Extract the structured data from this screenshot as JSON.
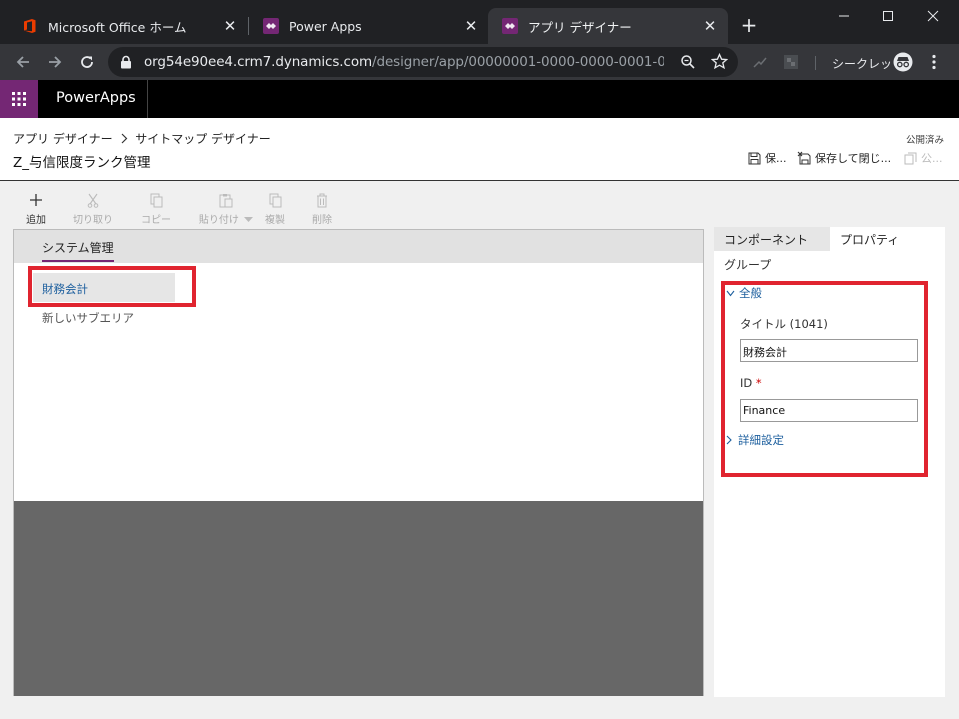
{
  "browser": {
    "tabs": [
      {
        "label": "Microsoft Office ホーム",
        "active": false
      },
      {
        "label": "Power Apps",
        "active": false
      },
      {
        "label": "アプリ デザイナー",
        "active": true
      }
    ],
    "url_host": "org54e90ee4.crm7.dynamics.com",
    "url_path": "/designer/app/00000001-0000-0000-0001-00000...",
    "incognito_label": "シークレット"
  },
  "header": {
    "product": "PowerApps"
  },
  "designer": {
    "breadcrumb_app": "アプリ デザイナー",
    "breadcrumb_current": "サイトマップ デザイナー",
    "app_title": "Z_与信限度ランク管理",
    "publish_state": "公開済み",
    "save_label": "保...",
    "save_close_label": "保存して閉じ...",
    "publish_label": "公..."
  },
  "commands": [
    {
      "label": "追加",
      "enabled": true
    },
    {
      "label": "切り取り",
      "enabled": false
    },
    {
      "label": "コピー",
      "enabled": false
    },
    {
      "label": "貼り付け",
      "enabled": false
    },
    {
      "label": "複製",
      "enabled": false
    },
    {
      "label": "削除",
      "enabled": false
    }
  ],
  "canvas": {
    "area_tab": "システム管理",
    "group_item": "財務会計",
    "subarea_item": "新しいサブエリア"
  },
  "panel": {
    "tab_components": "コンポーネント",
    "tab_properties": "プロパティ",
    "object_type": "グループ",
    "section_general": "全般",
    "title_label": "タイトル (1041)",
    "title_value": "財務会計",
    "id_label": "ID",
    "id_required": "*",
    "id_value": "Finance",
    "section_advanced": "詳細設定"
  },
  "colors": {
    "accent": "#742774",
    "highlight": "#e0242f",
    "link": "#1d5f9e"
  }
}
